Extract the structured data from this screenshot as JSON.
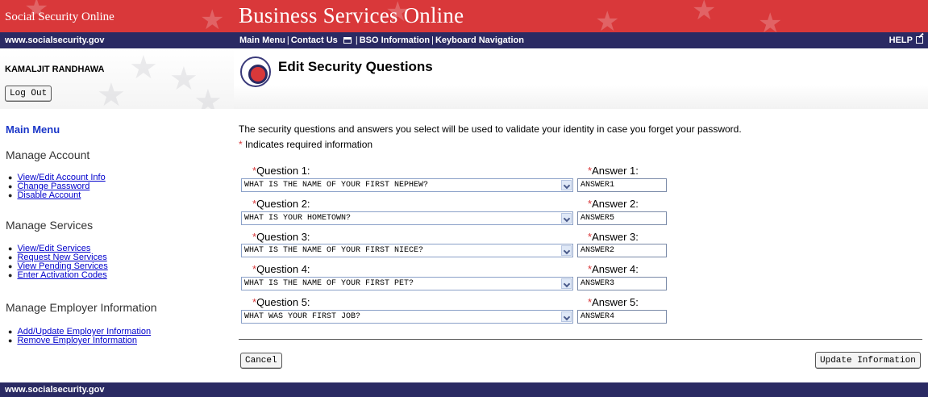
{
  "banner": {
    "brand": "Social Security Online",
    "title": "Business Services Online"
  },
  "nav": {
    "site_url": "www.socialsecurity.gov",
    "links": {
      "main_menu": "Main Menu",
      "contact_us": "Contact Us",
      "bso_information": "BSO Information",
      "keyboard_navigation": "Keyboard Navigation"
    },
    "separator": "|",
    "help": "HELP"
  },
  "user": {
    "name": "KAMALJIT RANDHAWA",
    "logout_label": "Log Out"
  },
  "page": {
    "title": "Edit Security Questions"
  },
  "sidebar": {
    "main_menu": "Main Menu",
    "sections": [
      {
        "heading": "Manage Account",
        "items": [
          "View/Edit Account Info",
          "Change Password",
          "Disable Account"
        ]
      },
      {
        "heading": "Manage Services",
        "items": [
          "View/Edit Services",
          "Request New Services",
          "View Pending Services",
          "Enter Activation Codes"
        ]
      },
      {
        "heading": "Manage Employer Information",
        "items": [
          "Add/Update Employer Information",
          "Remove Employer Information"
        ]
      }
    ]
  },
  "form": {
    "intro": "The security questions and answers you select will be used to validate your identity in case you forget your password.",
    "required_marker": "*",
    "required_note": " Indicates required information",
    "questions": [
      {
        "q_label": "Question 1:",
        "q_value": "WHAT IS THE NAME OF YOUR FIRST NEPHEW?",
        "a_label": "Answer 1:",
        "a_value": "ANSWER1"
      },
      {
        "q_label": "Question 2:",
        "q_value": "WHAT IS YOUR HOMETOWN?",
        "a_label": "Answer 2:",
        "a_value": "ANSWER5"
      },
      {
        "q_label": "Question 3:",
        "q_value": "WHAT IS THE NAME OF YOUR FIRST NIECE?",
        "a_label": "Answer 3:",
        "a_value": "ANSWER2"
      },
      {
        "q_label": "Question 4:",
        "q_value": "WHAT IS THE NAME OF YOUR FIRST PET?",
        "a_label": "Answer 4:",
        "a_value": "ANSWER3"
      },
      {
        "q_label": "Question 5:",
        "q_value": "WHAT WAS YOUR FIRST JOB?",
        "a_label": "Answer 5:",
        "a_value": "ANSWER4"
      }
    ],
    "cancel_label": "Cancel",
    "update_label": "Update Information"
  },
  "footer": {
    "url": "www.socialsecurity.gov"
  },
  "colors": {
    "banner_red": "#d9383a",
    "navy": "#2a2a63",
    "link_blue": "#0000cc",
    "menu_title_blue": "#1a36c8"
  }
}
